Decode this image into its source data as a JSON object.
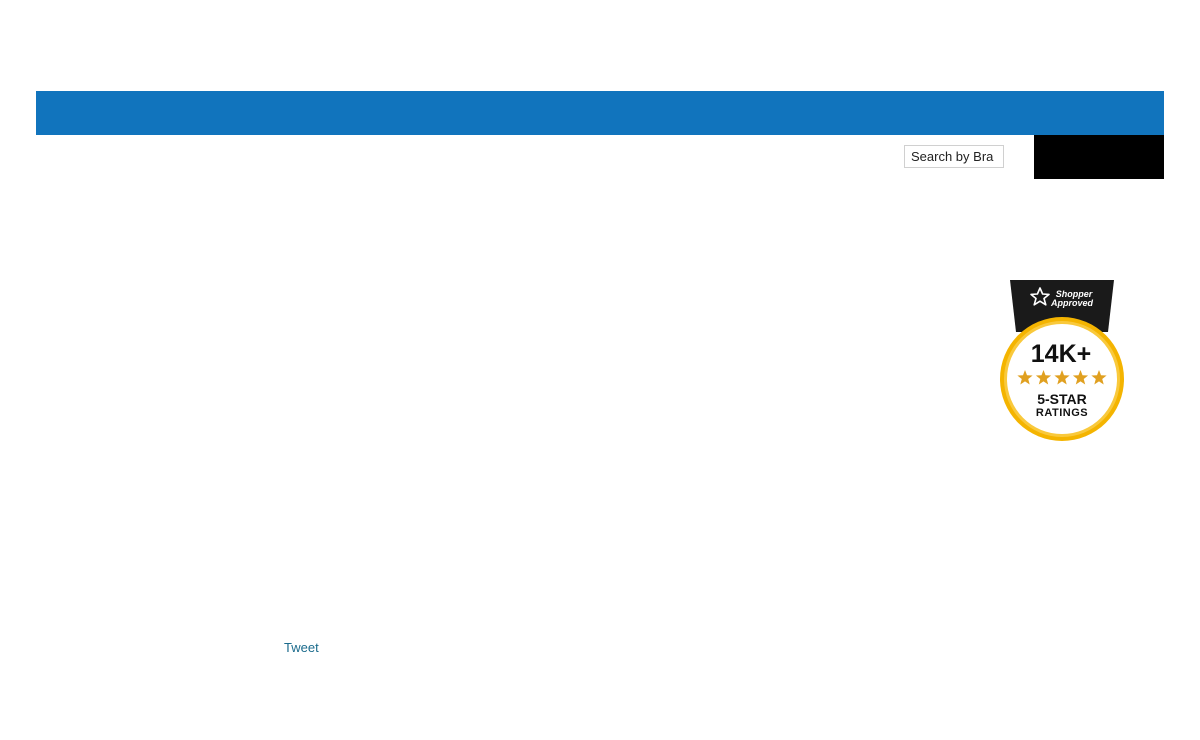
{
  "colors": {
    "header_bar": "#1174bd",
    "search_button": "#000000",
    "link": "#1b6b8c",
    "badge_gold": "#f4b400",
    "badge_dark": "#1a1a1a"
  },
  "search": {
    "value": "Search by Bra",
    "placeholder": "Search by Brand"
  },
  "badge": {
    "brand_line1": "Shopper",
    "brand_line2": "Approved",
    "count": "14K+",
    "stars": 5,
    "rating_line1": "5-STAR",
    "rating_line2": "RATINGS"
  },
  "social": {
    "tweet_label": "Tweet"
  }
}
